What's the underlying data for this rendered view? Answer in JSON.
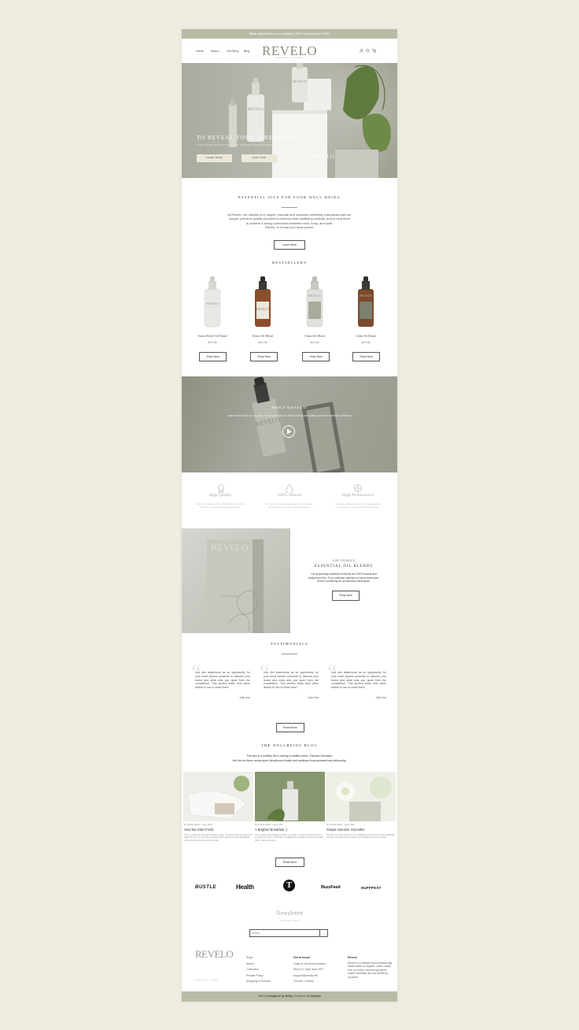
{
  "announcement": {
    "bold": "New",
    "text": " collection is now available | Free shipping over $150"
  },
  "nav": {
    "items": [
      "Home",
      "Shop",
      "Our Story",
      "Blog"
    ],
    "logo": "REVELO",
    "logo_tagline": "ESSENTIAL OIL BLENDS"
  },
  "hero": {
    "title": "TO REVEAL YOUR INNER PEACE",
    "subtitle": "100% PURE ESSENTIAL OILS FOR WELLBEING ENTHUSIASTS",
    "btn_learn": "LEARN MORE",
    "btn_shop": "SHOP NOW",
    "box_logo": "REVELO"
  },
  "intro": {
    "title": "ESSENTIAL OILS FOR YOUR WELL-BEING",
    "line1": "At Revelo, our mission is to inspire, educate and empower wellbeing enthusiasts with our",
    "line2": "unique, premium quality products to enhance their wellbeing routines, and to help them",
    "line3": "to achieve a strong connection between mind, body, and spirit.",
    "tagline": "Revelo, to reveal your inner peace.",
    "button": "Learn More"
  },
  "bestsellers": {
    "title": "BESTSELLERS",
    "products": [
      {
        "name": "Stress Relief Oil Blend",
        "price": "$19.95",
        "button": "Shop Now"
      },
      {
        "name": "Relax Oil Blend",
        "price": "$19.95",
        "button": "Shop Now"
      },
      {
        "name": "Clean Oil Blend",
        "price": "$19.95",
        "button": "Shop Now"
      },
      {
        "name": "Calm Oil Blend",
        "price": "$19.95",
        "button": "Shop Now"
      }
    ]
  },
  "meet": {
    "title": "MEET REVELO",
    "text": "Learn more about our process, our people and our 100% natural and totally toxin free essential oil blends."
  },
  "features": [
    {
      "title": "High Quality",
      "desc": "We're committed to only sell products made from the finest, the cleanest, highest-quality oils."
    },
    {
      "title": "100% Natural",
      "desc": "We source from sustainable land to our products, use products of oils with natural ingredients."
    },
    {
      "title": "High Performance",
      "desc": "All Revelo wellness products are designed and formulated to meet important effectiveness."
    }
  ],
  "promise": {
    "eyebrow": "OUR PROMISE",
    "title": "ESSENTIAL OIL BLENDS",
    "line1": "Our proprietary essential oil blends are 100% natural and",
    "line2": "totally toxin free. From wellness solutions to mood enhancers,",
    "line3": "there's something for all wellness enthusiasts.",
    "button": "Shop Now",
    "box_logo": "REVELO",
    "box_label": "CALM BLEND"
  },
  "testimonials": {
    "title": "TESTIMONIALS",
    "items": [
      {
        "text": "Use this testimonial as an opportunity for your most valued customer to discuss your brand and what sets you apart from the competition. This section looks best when limited to two or three lines!",
        "name": "John Doe"
      },
      {
        "text": "Use this testimonial as an opportunity for your most valued customer to discuss your brand and what sets you apart from the competition. This section looks best when limited to two or three lines!",
        "name": "John Doe"
      },
      {
        "text": "Use this testimonial as an opportunity for your most valued customer to discuss your brand and what sets you apart from the competition. This section looks best when limited to two or three lines!",
        "name": "John Doe"
      }
    ],
    "button": "Read More"
  },
  "blog": {
    "title": "THE WELLBEING BLOG",
    "quote": "The key to a healthy life is having a healthy mind - Richard Davidson",
    "sub": "We live by these words quite literally and health and wellness blog spreads that philosophy.",
    "posts": [
      {
        "meta": "By Jonathan Martin · Aug 8, 2022",
        "title": "How We Start Fresh",
        "excerpt": "This is a great hook intended sensation a space. You want to build your diet on the basics, the fact is it will be like a breakfast with a spinach-chopped and English muffin, could be the best way for yourself."
      },
      {
        "meta": "By Jonathan Martin · Aug 8, 2022",
        "title": "A Brighter Breakfast :)",
        "excerpt": "This is a great layer intended smoothie to a space. You want to build your diet on the basics, the fact is it will be like a breakfast with a spinach-chopped and English muffin, could be the best."
      },
      {
        "meta": "By Jonathan Martin · Aug 8, 2022",
        "title": "Simple Summer Smoothie",
        "excerpt": "The flavor is so smooth and you can really taste the freshness. It has a delightfully attractive and bright colour. It makes your breakfast start fresh and tasty."
      }
    ],
    "button": "Read More"
  },
  "press": [
    "BUSTLE",
    "Health",
    "T",
    "BuzzFeed",
    "HUFFPOST"
  ],
  "newsletter": {
    "title": "Newsletter",
    "sub": "Let's keep in touch",
    "placeholder": "Email",
    "submit": "→"
  },
  "footer": {
    "logo": "REVELO",
    "logo_tagline": "ESSENTIAL OIL BLENDS",
    "links": [
      "Shop",
      "About",
      "Collection",
      "Private Policy",
      "Shipping & Returns"
    ],
    "contact_title": "Get in touch",
    "contact": [
      "Order & General Inquiries",
      "Mon-Fri | 9am-4pm EST",
      "support@revelo.life",
      "Toronto, Ontario"
    ],
    "about_title": "Revelo",
    "about": "Revelo is a lifestyle brand meticulously made based on organic, clean cruelty free, no toxins, natural ingredients unique essential oils and wellbeing products."
  },
  "bottom": {
    "pre": "Site by ",
    "designer": "Designed by Betty",
    "mid": " | Powered by ",
    "platform": "Shopify"
  },
  "colors": {
    "page_bg": "#efece1",
    "accent": "#b8bca6",
    "hero_bg": "#a8ab9e",
    "white": "#ffffff"
  }
}
